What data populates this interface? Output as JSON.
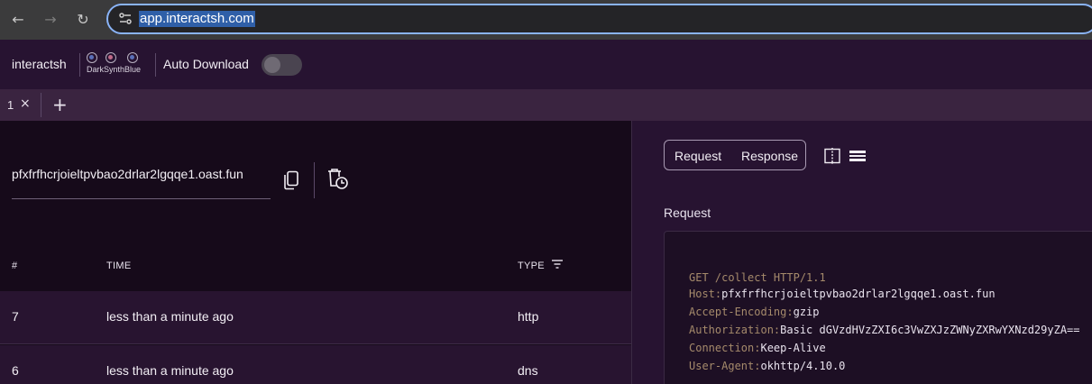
{
  "browser": {
    "back_icon": "←",
    "forward_icon": "→",
    "reload_icon": "↻",
    "url": "app.interactsh.com"
  },
  "header": {
    "brand": "interactsh",
    "theme_label": "DarkSynthBlue",
    "theme_colors": [
      "#5a6fb8",
      "#c06a88",
      "#5a6fb8"
    ],
    "auto_download_label": "Auto Download",
    "auto_download_on": false
  },
  "tabs": {
    "items": [
      {
        "label": "1",
        "close": "×"
      }
    ],
    "add": "+"
  },
  "interaction": {
    "url": "pfxfrfhcrjoieltpvbao2drlar2lgqqe1.oast.fun"
  },
  "table": {
    "headers": {
      "num": "#",
      "time": "TIME",
      "type": "TYPE"
    },
    "rows": [
      {
        "num": "7",
        "time": "less than a minute ago",
        "type": "http"
      },
      {
        "num": "6",
        "time": "less than a minute ago",
        "type": "dns"
      }
    ]
  },
  "detail": {
    "tabs": {
      "request": "Request",
      "response": "Response"
    },
    "request_heading": "Request",
    "request_line": "GET /collect HTTP/1.1",
    "headers": [
      {
        "name": "Host:",
        "value": "pfxfrfhcrjoieltpvbao2drlar2lgqqe1.oast.fun"
      },
      {
        "name": "Accept-Encoding:",
        "value": "gzip"
      },
      {
        "name": "Authorization:",
        "value": "Basic dGVzdHVzZXI6c3VwZXJzZWNyZXRwYXNzd29yZA=="
      },
      {
        "name": "Connection:",
        "value": "Keep-Alive"
      },
      {
        "name": "User-Agent:",
        "value": "okhttp/4.10.0"
      }
    ]
  }
}
